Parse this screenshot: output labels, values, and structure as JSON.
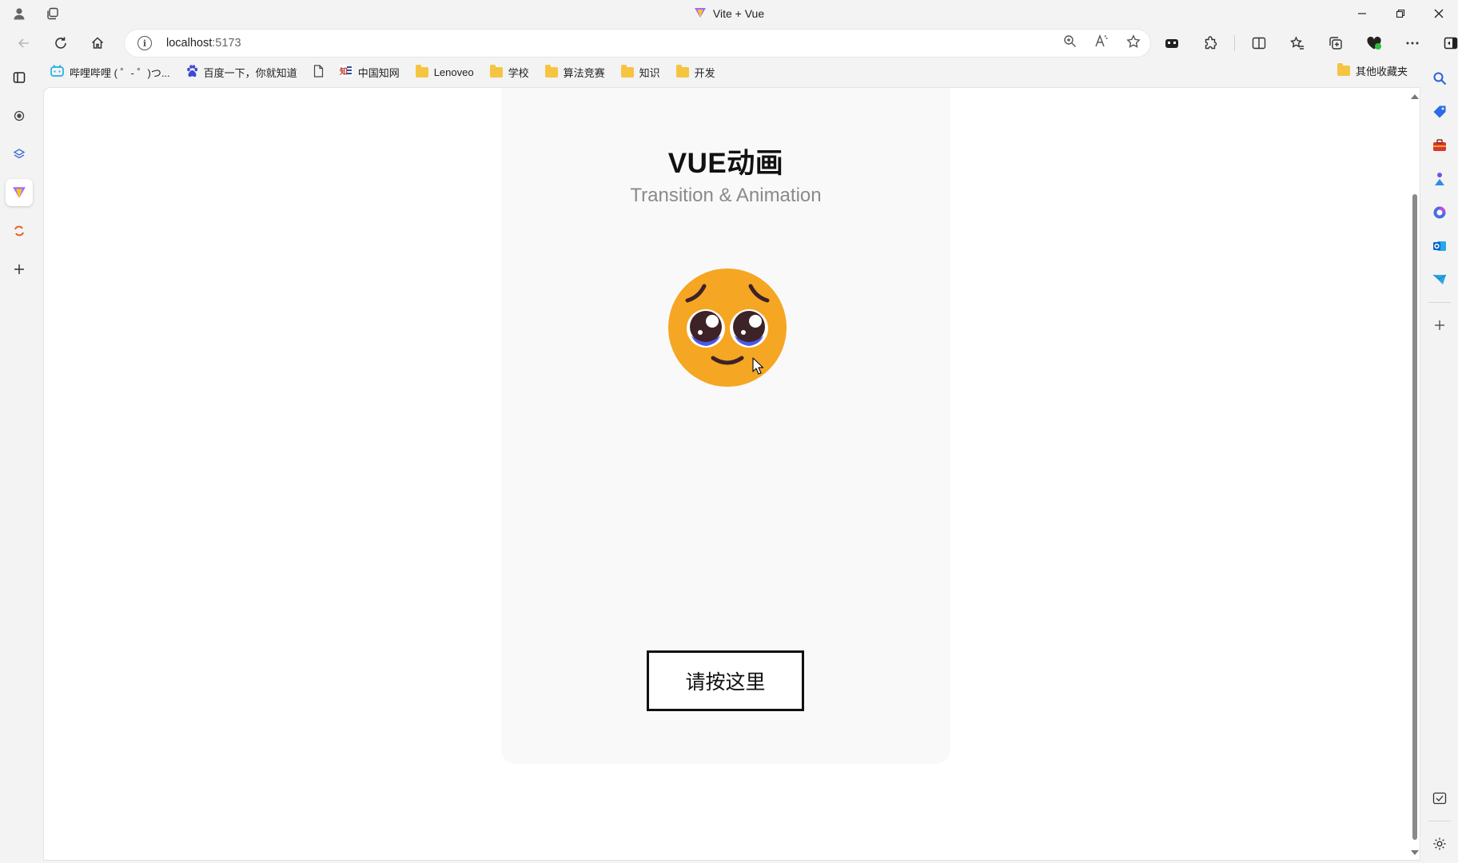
{
  "window": {
    "title": "Vite + Vue"
  },
  "nav": {
    "url_host": "localhost",
    "url_port": ":5173"
  },
  "bookmarks": [
    {
      "label": "哔哩哔哩 ( ゜- ゜)つ...",
      "icon": "bilibili-icon"
    },
    {
      "label": "百度一下，你就知道",
      "icon": "baidu-icon"
    },
    {
      "label": "",
      "icon": "page-icon"
    },
    {
      "label": "中国知网",
      "icon": "cnki-icon"
    },
    {
      "label": "Lenoveo",
      "icon": "folder-icon"
    },
    {
      "label": "学校",
      "icon": "folder-icon"
    },
    {
      "label": "算法竞赛",
      "icon": "folder-icon"
    },
    {
      "label": "知识",
      "icon": "folder-icon"
    },
    {
      "label": "开发",
      "icon": "folder-icon"
    }
  ],
  "bookmarks_other": {
    "label": "其他收藏夹",
    "icon": "folder-icon"
  },
  "page": {
    "title": "VUE动画",
    "subtitle": "Transition & Animation",
    "button_label": "请按这里",
    "emoji": "pleading-face"
  },
  "colors": {
    "accent": "#f5a623",
    "emoji_face": "#f5a623",
    "emoji_eye": "#3d2227",
    "emoji_tear": "#4a5ae8",
    "card_bg": "#f9f9f9"
  }
}
